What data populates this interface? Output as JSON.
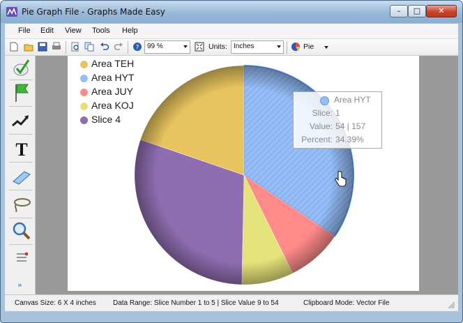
{
  "window": {
    "title": "Pie Graph File - Graphs Made Easy",
    "minimize_glyph": "–",
    "maximize_glyph": "□",
    "close_glyph": "✕"
  },
  "menu": [
    "File",
    "Edit",
    "View",
    "Tools",
    "Help"
  ],
  "toolbar": {
    "zoom_value": "99 %",
    "units_label": "Units:",
    "units_value": "Inches",
    "chart_type_value": "Pie",
    "icons": [
      "new-icon",
      "open-icon",
      "save-icon",
      "print-icon",
      "print-preview-icon",
      "copy-icon",
      "undo-icon",
      "redo-icon",
      "help-icon",
      "zoom-icon",
      "fit-icon",
      "pie-type-icon"
    ]
  },
  "left_tools": [
    "select-check-icon",
    "flag-icon",
    "trend-line-icon",
    "text-tool-icon",
    "eraser-icon",
    "lasso-icon",
    "magnifier-icon",
    "list-icon"
  ],
  "left_expand_glyph": "»",
  "chart_data": {
    "type": "pie",
    "title": "",
    "legend_position": "top-left",
    "slices": [
      {
        "label": "Area TEH",
        "value": 31,
        "color": "#e8c45e"
      },
      {
        "label": "Area HYT",
        "value": 54,
        "color": "#95bdf6"
      },
      {
        "label": "Area JUY",
        "value": 13,
        "color": "#ff8a8a"
      },
      {
        "label": "Area KOJ",
        "value": 12,
        "color": "#e6e27a"
      },
      {
        "label": "Slice 4",
        "value": 47,
        "color": "#8f6db0"
      }
    ],
    "total": 157
  },
  "tooltip": {
    "title": "Area HYT",
    "slice_label": "Slice:",
    "slice_value": "1",
    "value_label": "Value:",
    "value_value": "54  |  157",
    "percent_label": "Percent:",
    "percent_value": "34.39%"
  },
  "status": {
    "canvas_size": "Canvas Size:  6 X 4  inches",
    "data_range": "Data Range:  Slice Number 1 to 5  |  Slice Value 9 to 54",
    "clipboard": "Clipboard Mode: Vector File"
  }
}
